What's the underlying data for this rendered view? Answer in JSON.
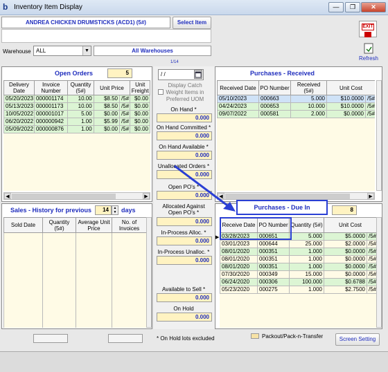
{
  "window": {
    "title": "Inventory Item Display",
    "app_letter": "b",
    "minimize_glyph": "—",
    "maximize_glyph": "❐",
    "close_glyph": "✕"
  },
  "item": {
    "name": "ANDREA CHICKEN DRUMSTICKS  (ACD1)  (5#)",
    "select_label": "Select Item",
    "exit_label": "EXIT",
    "refresh_label": "Refresh"
  },
  "warehouse": {
    "label": "Warehouse",
    "value": "ALL",
    "display": "All Warehouses"
  },
  "open_orders": {
    "title": "Open Orders",
    "count": "5",
    "columns": [
      "Delivery Date",
      "Invoice Number",
      "Quantity (5#)",
      "Unit Price",
      "Unit Freight"
    ],
    "rows": [
      [
        "05/20/2023",
        "000001174",
        "10.00",
        "$8.50",
        "/5#",
        "$0.00"
      ],
      [
        "05/13/2023",
        "000001173",
        "10.00",
        "$8.50",
        "/5#",
        "$0.00"
      ],
      [
        "10/05/2022",
        "000001017",
        "5.00",
        "$0.00",
        "/5#",
        "$0.00"
      ],
      [
        "06/20/2022",
        "000000942",
        "1.00",
        "$5.99",
        "/5#",
        "$0.00"
      ],
      [
        "05/09/2022",
        "000000876",
        "1.00",
        "$0.00",
        "/5#",
        "$0.00"
      ]
    ]
  },
  "middle": {
    "date_value": "/ /",
    "date_small": "1/14",
    "catch_weight_label": "Display Catch Weight Items in Preferred UOM",
    "fields": [
      {
        "label": "On Hand *",
        "value": "0.000"
      },
      {
        "label": "On Hand Committed *",
        "value": "0.000"
      },
      {
        "label": "On Hand Available *",
        "value": "0.000"
      },
      {
        "label": "Unallocated Orders *",
        "value": "0.000"
      },
      {
        "label": "Open PO's *",
        "value": "0.000"
      },
      {
        "label": "Allocated Against Open PO's *",
        "value": "0.000"
      },
      {
        "label": "In-Process Alloc. *",
        "value": "0.000"
      },
      {
        "label": "In-Process Unalloc. *",
        "value": "0.000"
      },
      {
        "label": "Available to Sell *",
        "value": "0.000"
      },
      {
        "label": "On Hold",
        "value": "0.000"
      }
    ]
  },
  "purchases_received": {
    "title": "Purchases - Received",
    "columns": [
      "Received Date",
      "PO Number",
      "Received (5#)",
      "Unit Cost"
    ],
    "rows": [
      [
        "05/10/2023",
        "000663",
        "5.000",
        "$10.0000",
        "/5#"
      ],
      [
        "04/24/2023",
        "000653",
        "10.000",
        "$10.0000",
        "/5#"
      ],
      [
        "09/07/2022",
        "000581",
        "2.000",
        "$0.0000",
        "/5#"
      ]
    ]
  },
  "sales_history": {
    "title_prefix": "Sales - History for previous",
    "days_value": "14",
    "title_suffix": "days",
    "columns": [
      "Sold Date",
      "Quantity (5#)",
      "Average Unit Price",
      "No. of Invoices"
    ]
  },
  "purchases_due": {
    "title": "Purchases - Due In",
    "count": "8",
    "columns": [
      "Receive Date",
      "PO Number",
      "Quantity (5#)",
      "Unit Cost"
    ],
    "rows": [
      [
        "03/28/2023",
        "000651",
        "5.000",
        "$5.0000",
        "/5#"
      ],
      [
        "03/01/2023",
        "000644",
        "25.000",
        "$2.0000",
        "/5#"
      ],
      [
        "08/01/2020",
        "000351",
        "1.000",
        "$0.0000",
        "/5#"
      ],
      [
        "08/01/2020",
        "000351",
        "1.000",
        "$0.0000",
        "/5#"
      ],
      [
        "08/01/2020",
        "000351",
        "1.000",
        "$0.0000",
        "/5#"
      ],
      [
        "07/30/2020",
        "000349",
        "15.000",
        "$0.0000",
        "/5#"
      ],
      [
        "06/24/2020",
        "000306",
        "100.000",
        "$0.6788",
        "/5#"
      ],
      [
        "05/23/2020",
        "000275",
        "1.000",
        "$2.7500",
        "/5#"
      ]
    ]
  },
  "footer": {
    "note": "* On Hold lots excluded",
    "legend": "Packout/Pack-n-Transfer",
    "screen_setting": "Screen Setting"
  },
  "colors": {
    "accent_blue": "#1f2dbd",
    "green_row": "#dcf5d4",
    "yellow_field": "#fff3c2",
    "highlight_box": "#2a3fd4"
  }
}
